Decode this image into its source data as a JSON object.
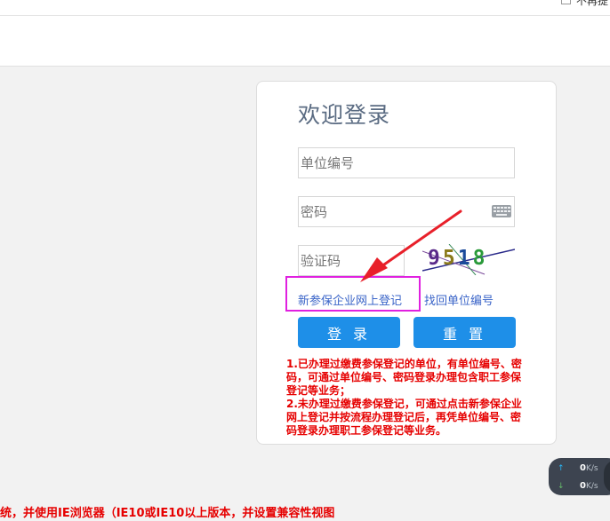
{
  "topbar": {
    "checkbox_label": "不再提"
  },
  "login": {
    "title": "欢迎登录",
    "unit_placeholder": "单位编号",
    "password_placeholder": "密码",
    "captcha_placeholder": "验证码",
    "captcha_text": "9518",
    "new_registration_link": "新参保企业网上登记",
    "retrieve_unit_link": "找回单位编号",
    "login_button": "登 录",
    "reset_button": "重 置",
    "notice": [
      "1.已办理过缴费参保登记的单位，有单位编号、密码，可通过单位编号、密码登录办理包含职工参保登记等业务；",
      "2.未办理过缴费参保登记，可通过点击新参保企业网上登记并按流程办理登记后，再凭单位编号、密码登录办理职工参保登记等业务。"
    ]
  },
  "footer": {
    "browser_hint": "统，并使用IE浏览器（IE10或IE10以上版本，并设置兼容性视图"
  },
  "speed_widget": {
    "upload_value": "0",
    "download_value": "0",
    "unit": "K/s"
  },
  "colors": {
    "accent": "#1e8fe8",
    "title": "#5a6b82",
    "link": "#3a64c8",
    "notice": "#e60000",
    "highlight_box": "#e020e0",
    "annotation_arrow": "#e8202a"
  }
}
